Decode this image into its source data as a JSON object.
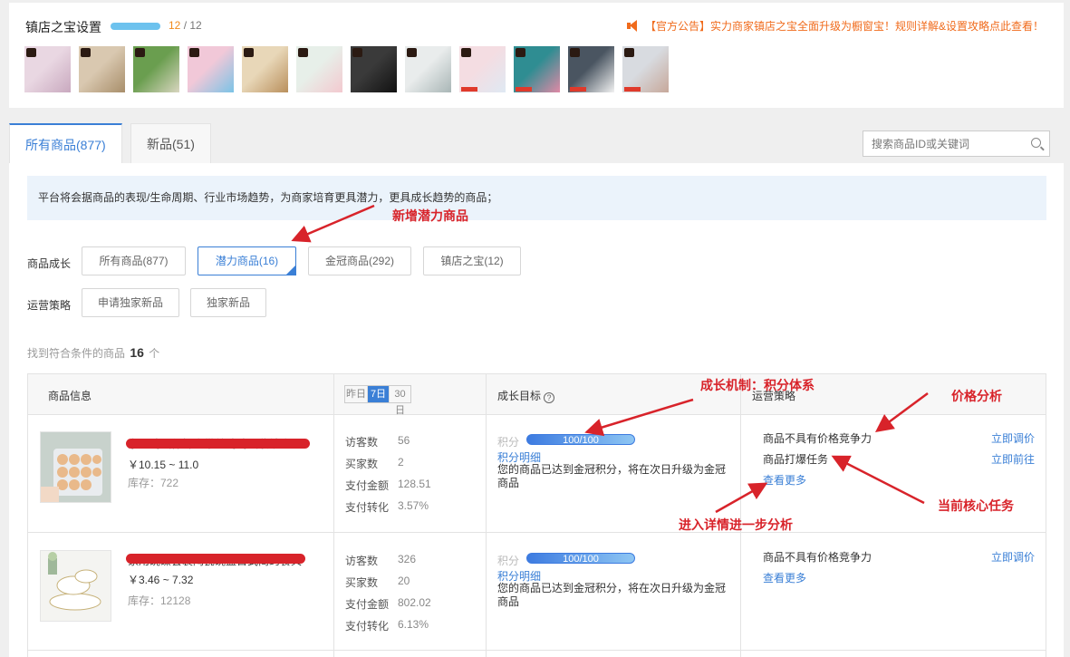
{
  "top": {
    "title": "镇店之宝设置",
    "progress_count": "12",
    "progress_sep": " / ",
    "progress_total": "12",
    "notice": "【官方公告】实力商家镇店之宝全面升级为橱窗宝！规则详解&设置攻略点此查看！",
    "thumbnails": [
      {
        "colors": [
          "#e9d7e2",
          "#c9a9bf"
        ]
      },
      {
        "colors": [
          "#d9c8b0",
          "#a88e6a"
        ]
      },
      {
        "colors": [
          "#6a9e4f",
          "#d9d6c0"
        ]
      },
      {
        "colors": [
          "#f1c8d8",
          "#7bc3e6"
        ]
      },
      {
        "colors": [
          "#e8d7b8",
          "#b98f5c"
        ]
      },
      {
        "colors": [
          "#e7efe9",
          "#f3c9cf"
        ]
      },
      {
        "colors": [
          "#3a3a3a",
          "#111111"
        ]
      },
      {
        "colors": [
          "#e9ecec",
          "#a9b6b6"
        ]
      },
      {
        "colors": [
          "#f4dde2",
          "#dfe9f3"
        ]
      },
      {
        "colors": [
          "#2f8d92",
          "#e08aa6"
        ]
      },
      {
        "colors": [
          "#4a5561",
          "#f2f2f2"
        ]
      },
      {
        "colors": [
          "#d8dbe0",
          "#c7a89a"
        ]
      }
    ]
  },
  "tabs": [
    {
      "label": "所有商品(877)",
      "active": true
    },
    {
      "label": "新品(51)",
      "active": false
    }
  ],
  "search": {
    "placeholder": "搜索商品ID或关键词"
  },
  "banner": "平台将会据商品的表现/生命周期、行业市场趋势，为商家培育更具潜力，更具成长趋势的商品；",
  "annotations": {
    "new_potential": "新增潜力商品",
    "growth_mechanism": "成长机制：积分体系",
    "price_analysis": "价格分析",
    "core_task": "当前核心任务",
    "detail_analysis": "进入详情进一步分析"
  },
  "filters": {
    "growth_label": "商品成长",
    "growth_options": [
      {
        "label": "所有商品(877)",
        "active": false
      },
      {
        "label": "潜力商品(16)",
        "active": true
      },
      {
        "label": "金冠商品(292)",
        "active": false
      },
      {
        "label": "镇店之宝(12)",
        "active": false
      }
    ],
    "strategy_label": "运营策略",
    "strategy_options": [
      {
        "label": "申请独家新品"
      },
      {
        "label": "独家新品"
      }
    ]
  },
  "results": {
    "prefix": "找到符合条件的商品",
    "count": "16",
    "suffix": "个"
  },
  "table": {
    "headers": {
      "product": "商品信息",
      "periods": [
        "昨日",
        "7日",
        "30日"
      ],
      "active_period": "7日",
      "growth": "成长目标",
      "strategy": "运营策略"
    },
    "rows": [
      {
        "title": "家用鸡蛋保鲜盒带盖鸡鸡蛋收纳盒",
        "price": "￥10.15 ~ 11.0",
        "stock": "库存：722",
        "metrics": [
          {
            "label": "访客数",
            "value": "56"
          },
          {
            "label": "买家数",
            "value": "2"
          },
          {
            "label": "支付金额",
            "value": "128.51"
          },
          {
            "label": "支付转化",
            "value": "3.57%"
          }
        ],
        "score_label": "积分",
        "score_text": "100/100",
        "score_progress": 1.0,
        "score_link": "积分明细",
        "goal_text": "您的商品已达到金冠积分，将在次日升级为金冠商品",
        "strategies": [
          {
            "text": "商品不具有价格竞争力",
            "action": "立即调价"
          },
          {
            "text": "商品打爆任务",
            "action": "立即前往"
          }
        ],
        "more": "查看更多",
        "img_colors": [
          "#e9b98a",
          "#c8d2cc"
        ]
      },
      {
        "title": "家用碗碟套装陶瓷碗盘日式简约餐具",
        "price": "￥3.46 ~ 7.32",
        "stock": "库存：12128",
        "metrics": [
          {
            "label": "访客数",
            "value": "326"
          },
          {
            "label": "买家数",
            "value": "20"
          },
          {
            "label": "支付金额",
            "value": "802.02"
          },
          {
            "label": "支付转化",
            "value": "6.13%"
          }
        ],
        "score_label": "积分",
        "score_text": "100/100",
        "score_progress": 1.0,
        "score_link": "积分明细",
        "goal_text": "您的商品已达到金冠积分，将在次日升级为金冠商品",
        "strategies": [
          {
            "text": "商品不具有价格竞争力",
            "action": "立即调价"
          }
        ],
        "more": "查看更多",
        "img_colors": [
          "#f4f4f1",
          "#c7b27a"
        ]
      }
    ]
  },
  "colors": {
    "accent": "#3a7fd6",
    "notice": "#f06b1c",
    "annotation": "#d8232a"
  }
}
